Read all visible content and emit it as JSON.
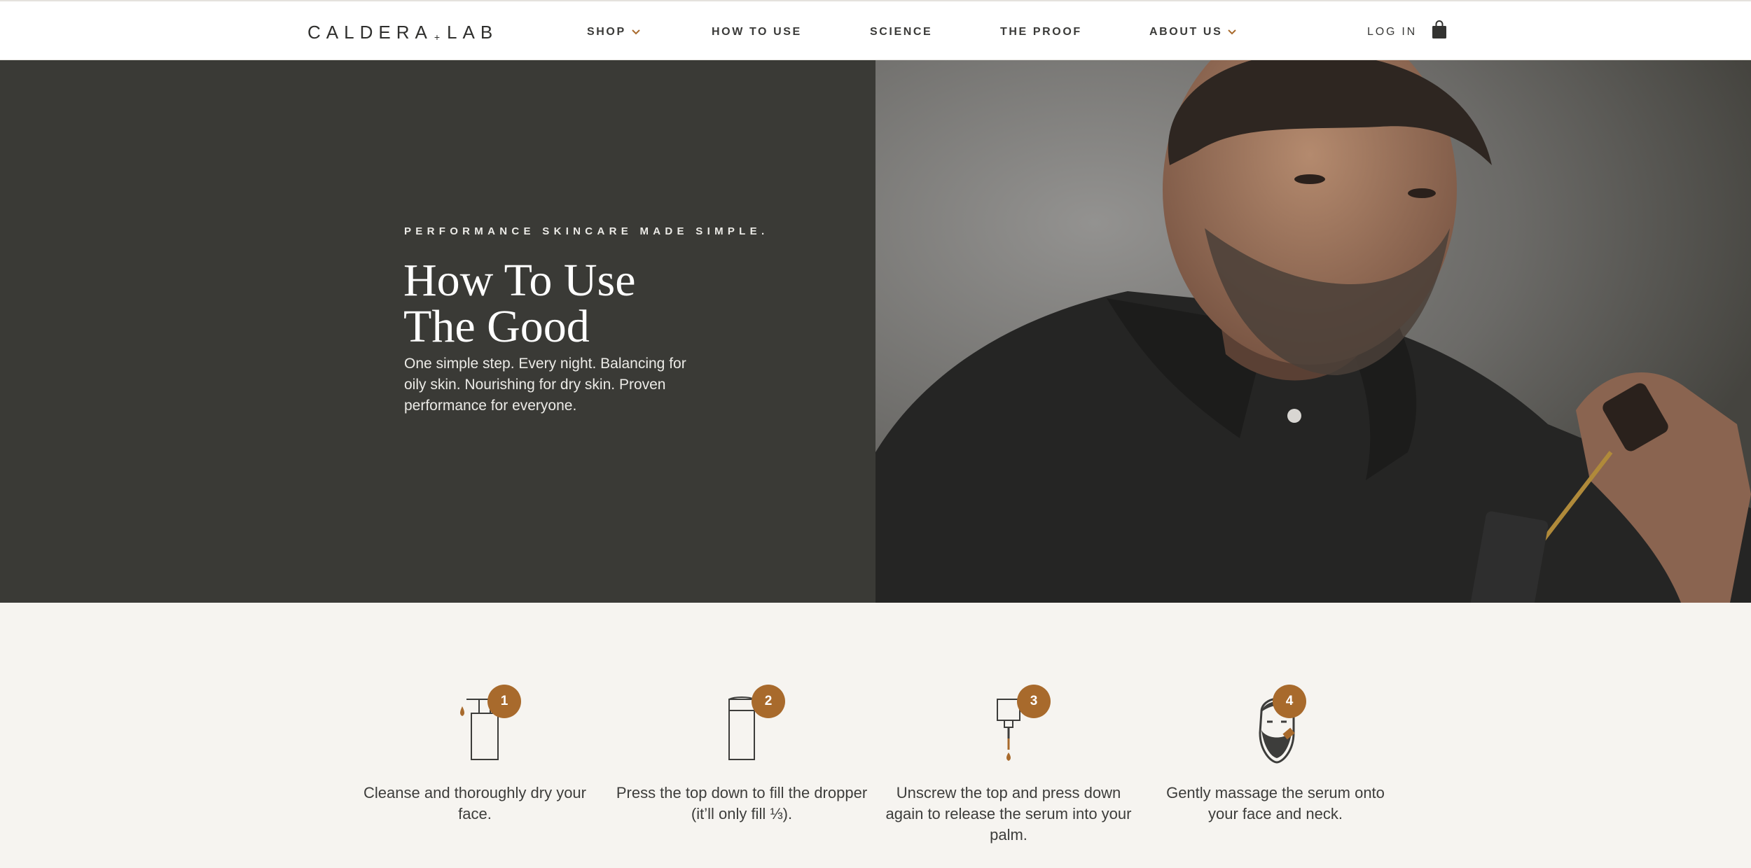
{
  "header": {
    "logo": {
      "left": "CALDERA",
      "plus": "+",
      "right": "LAB"
    },
    "nav": [
      {
        "label": "SHOP",
        "has_dropdown": true
      },
      {
        "label": "HOW TO USE",
        "has_dropdown": false
      },
      {
        "label": "SCIENCE",
        "has_dropdown": false
      },
      {
        "label": "THE PROOF",
        "has_dropdown": false
      },
      {
        "label": "ABOUT US",
        "has_dropdown": true
      }
    ],
    "login_label": "LOG IN",
    "cart_icon": "shopping-bag-icon"
  },
  "hero": {
    "eyebrow": "PERFORMANCE SKINCARE MADE SIMPLE.",
    "title_line1": "How To Use",
    "title_line2": "The Good",
    "description": "One simple step. Every night. Balancing for oily skin. Nourishing for dry skin. Proven performance for everyone."
  },
  "steps": [
    {
      "number": "1",
      "icon": "cleanser-pump-bottle-icon",
      "text": "Cleanse and thoroughly dry your face."
    },
    {
      "number": "2",
      "icon": "serum-bottle-press-icon",
      "text": "Press the top down to fill the dropper (it’ll only fill ⅓)."
    },
    {
      "number": "3",
      "icon": "dropper-release-icon",
      "text": "Unscrew the top and press down again to release the serum into your palm."
    },
    {
      "number": "4",
      "icon": "face-massage-icon",
      "text": "Gently massage the serum onto your face and neck."
    }
  ],
  "colors": {
    "accent": "#a86a2c",
    "hero_dark": "#3a3a36",
    "background": "#f6f4f0",
    "header_bg": "#ffffff"
  }
}
